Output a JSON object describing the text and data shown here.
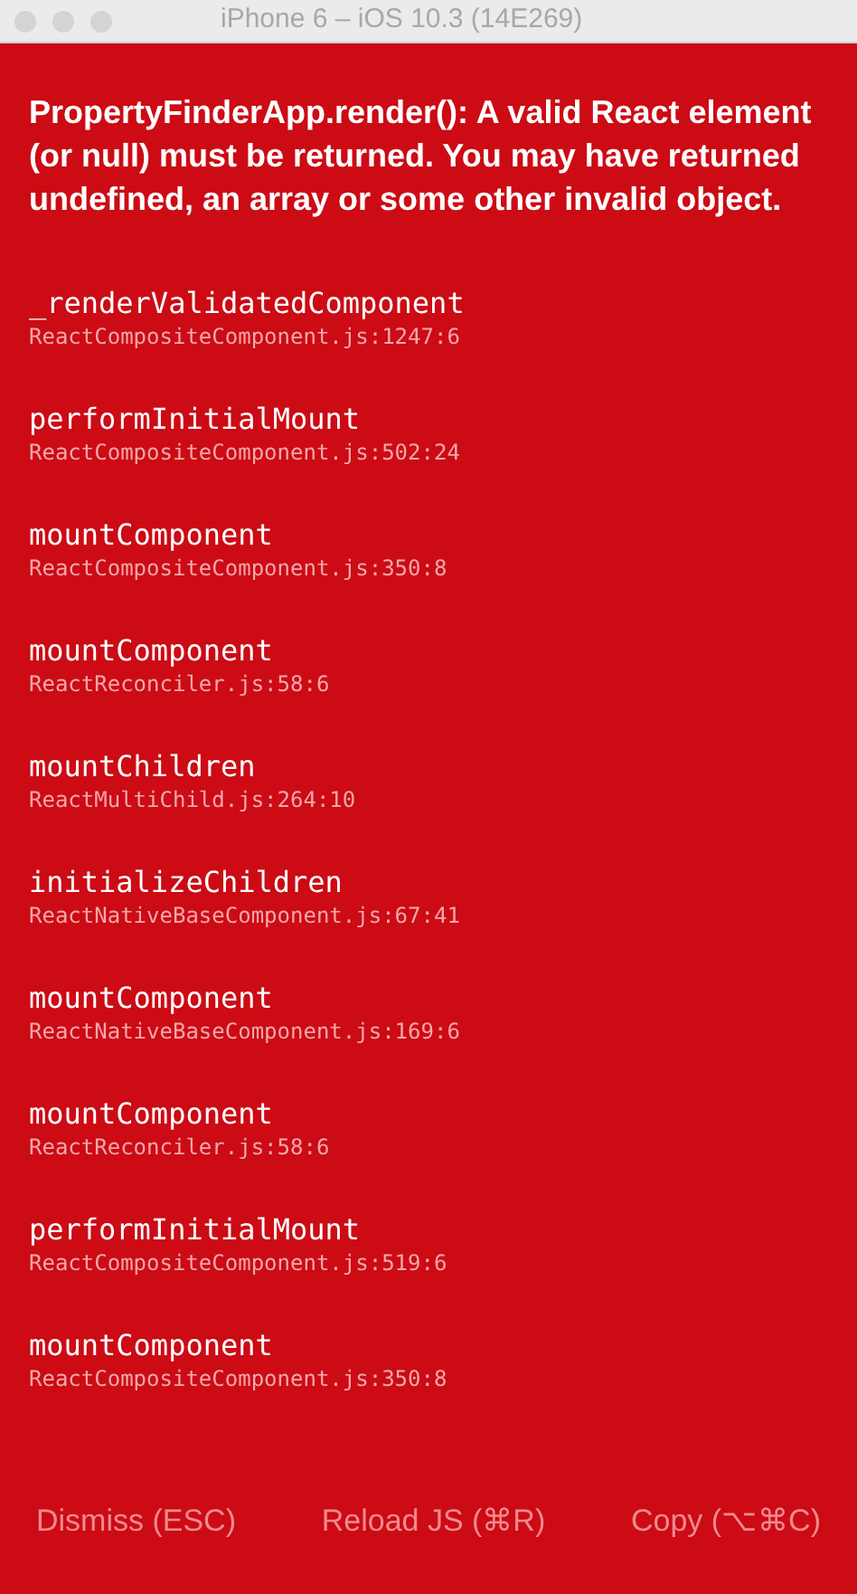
{
  "window": {
    "title": "iPhone 6 – iOS 10.3 (14E269)"
  },
  "error": {
    "message": "PropertyFinderApp.render(): A valid React element (or null) must be returned. You may have returned undefined, an array or some other invalid object."
  },
  "stack": [
    {
      "method": "_renderValidatedComponent",
      "file": "ReactCompositeComponent.js:1247:6"
    },
    {
      "method": "performInitialMount",
      "file": "ReactCompositeComponent.js:502:24"
    },
    {
      "method": "mountComponent",
      "file": "ReactCompositeComponent.js:350:8"
    },
    {
      "method": "mountComponent",
      "file": "ReactReconciler.js:58:6"
    },
    {
      "method": "mountChildren",
      "file": "ReactMultiChild.js:264:10"
    },
    {
      "method": "initializeChildren",
      "file": "ReactNativeBaseComponent.js:67:41"
    },
    {
      "method": "mountComponent",
      "file": "ReactNativeBaseComponent.js:169:6"
    },
    {
      "method": "mountComponent",
      "file": "ReactReconciler.js:58:6"
    },
    {
      "method": "performInitialMount",
      "file": "ReactCompositeComponent.js:519:6"
    },
    {
      "method": "mountComponent",
      "file": "ReactCompositeComponent.js:350:8"
    }
  ],
  "buttons": [
    "Dismiss (ESC)",
    "Reload JS (⌘R)",
    "Copy (⌥⌘C)"
  ]
}
